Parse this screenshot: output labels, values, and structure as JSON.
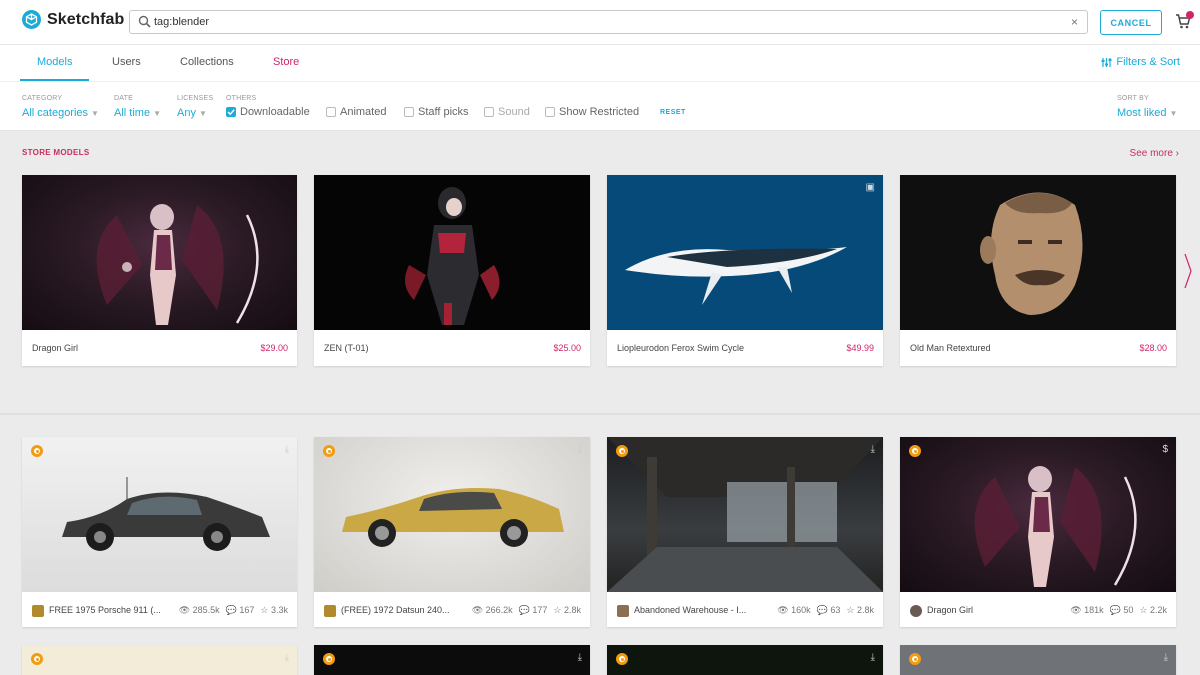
{
  "header": {
    "brand": "Sketchfab",
    "search_value": "tag:blender",
    "clear_icon": "close-icon",
    "cancel_label": "CANCEL",
    "cart_icon": "cart-icon"
  },
  "tabs": [
    {
      "label": "Models"
    },
    {
      "label": "Users"
    },
    {
      "label": "Collections"
    },
    {
      "label": "Store"
    }
  ],
  "filters_sort_label": "Filters & Sort",
  "filters": {
    "category": {
      "label": "CATEGORY",
      "value": "All categories"
    },
    "date": {
      "label": "DATE",
      "value": "All time"
    },
    "licenses": {
      "label": "LICENSES",
      "value": "Any"
    },
    "others_label": "OTHERS",
    "checkboxes": [
      {
        "label": "Downloadable",
        "checked": true
      },
      {
        "label": "Animated",
        "checked": false
      },
      {
        "label": "Staff picks",
        "checked": false
      },
      {
        "label": "Sound",
        "checked": false
      },
      {
        "label": "Show Restricted",
        "checked": false
      }
    ],
    "reset_label": "RESET",
    "sort": {
      "label": "SORT BY",
      "value": "Most liked"
    }
  },
  "store": {
    "title": "STORE MODELS",
    "see_more": "See more ›",
    "items": [
      {
        "title": "Dragon Girl",
        "price": "$29.00"
      },
      {
        "title": "ZEN (T-01)",
        "price": "$25.00"
      },
      {
        "title": "Liopleurodon Ferox Swim Cycle",
        "price": "$49.99"
      },
      {
        "title": "Old Man Retextured",
        "price": "$28.00"
      }
    ]
  },
  "models": [
    {
      "title": "FREE 1975 Porsche 911 (...",
      "views": "285.5k",
      "comments": "167",
      "likes": "3.3k"
    },
    {
      "title": "(FREE) 1972 Datsun 240...",
      "views": "266.2k",
      "comments": "177",
      "likes": "2.8k"
    },
    {
      "title": "Abandoned Warehouse - I...",
      "views": "160k",
      "comments": "63",
      "likes": "2.8k"
    },
    {
      "title": "Dragon Girl",
      "views": "181k",
      "comments": "50",
      "likes": "2.2k"
    }
  ],
  "colors": {
    "accent": "#1caad9",
    "store": "#d0246b",
    "badge": "#f39c12"
  }
}
